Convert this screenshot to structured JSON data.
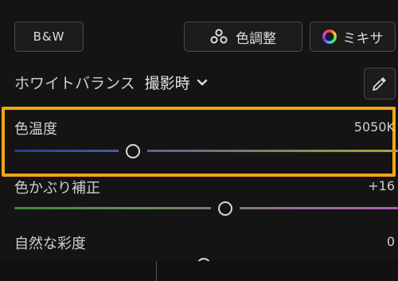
{
  "buttons": {
    "bw_label": "B&W",
    "color_adjust_label": "色調整",
    "mixer_label": "ミキサ"
  },
  "white_balance": {
    "label": "ホワイトバランス",
    "value": "撮影時"
  },
  "sliders": {
    "temperature": {
      "label": "色温度",
      "value": "5050K",
      "position": 0.31
    },
    "tint": {
      "label": "色かぶり補正",
      "value": "+16",
      "position": 0.55
    },
    "vibrance": {
      "label": "自然な彩度",
      "value": "0"
    }
  },
  "colors": {
    "highlight": "#f5a517",
    "background": "#141414"
  },
  "icons": [
    "three-dots-icon",
    "color-wheel-icon",
    "chevron-down-icon",
    "eyedropper-icon"
  ]
}
